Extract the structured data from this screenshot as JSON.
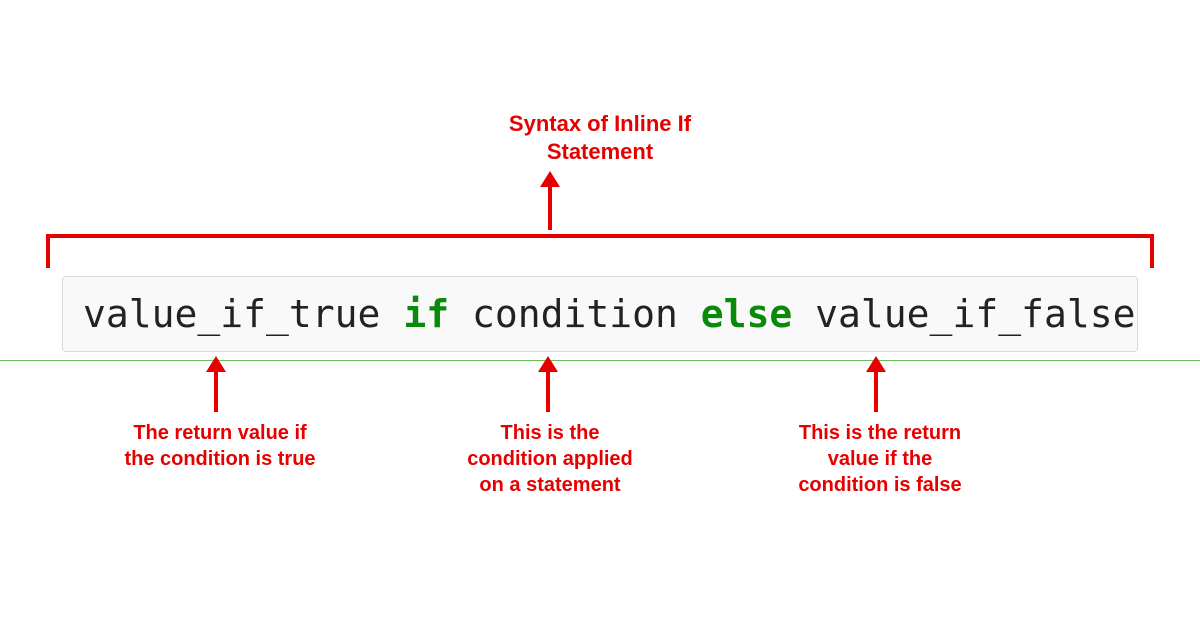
{
  "title": "Syntax of Inline If\nStatement",
  "code": {
    "value_if_true": "value_if_true",
    "if_kw": "if",
    "condition": "condition",
    "else_kw": "else",
    "value_if_false": "value_if_false"
  },
  "annotations": {
    "true_label": "The return value if\nthe condition is true",
    "condition_label": "This is the\ncondition applied\non a statement",
    "false_label": "This is the return\nvalue if the\ncondition is false"
  },
  "colors": {
    "accent": "#e60000",
    "keyword": "#0a8a0a",
    "code_bg": "#f9f9f9",
    "code_border": "#d9d9d9",
    "divider": "#6bbf59"
  }
}
